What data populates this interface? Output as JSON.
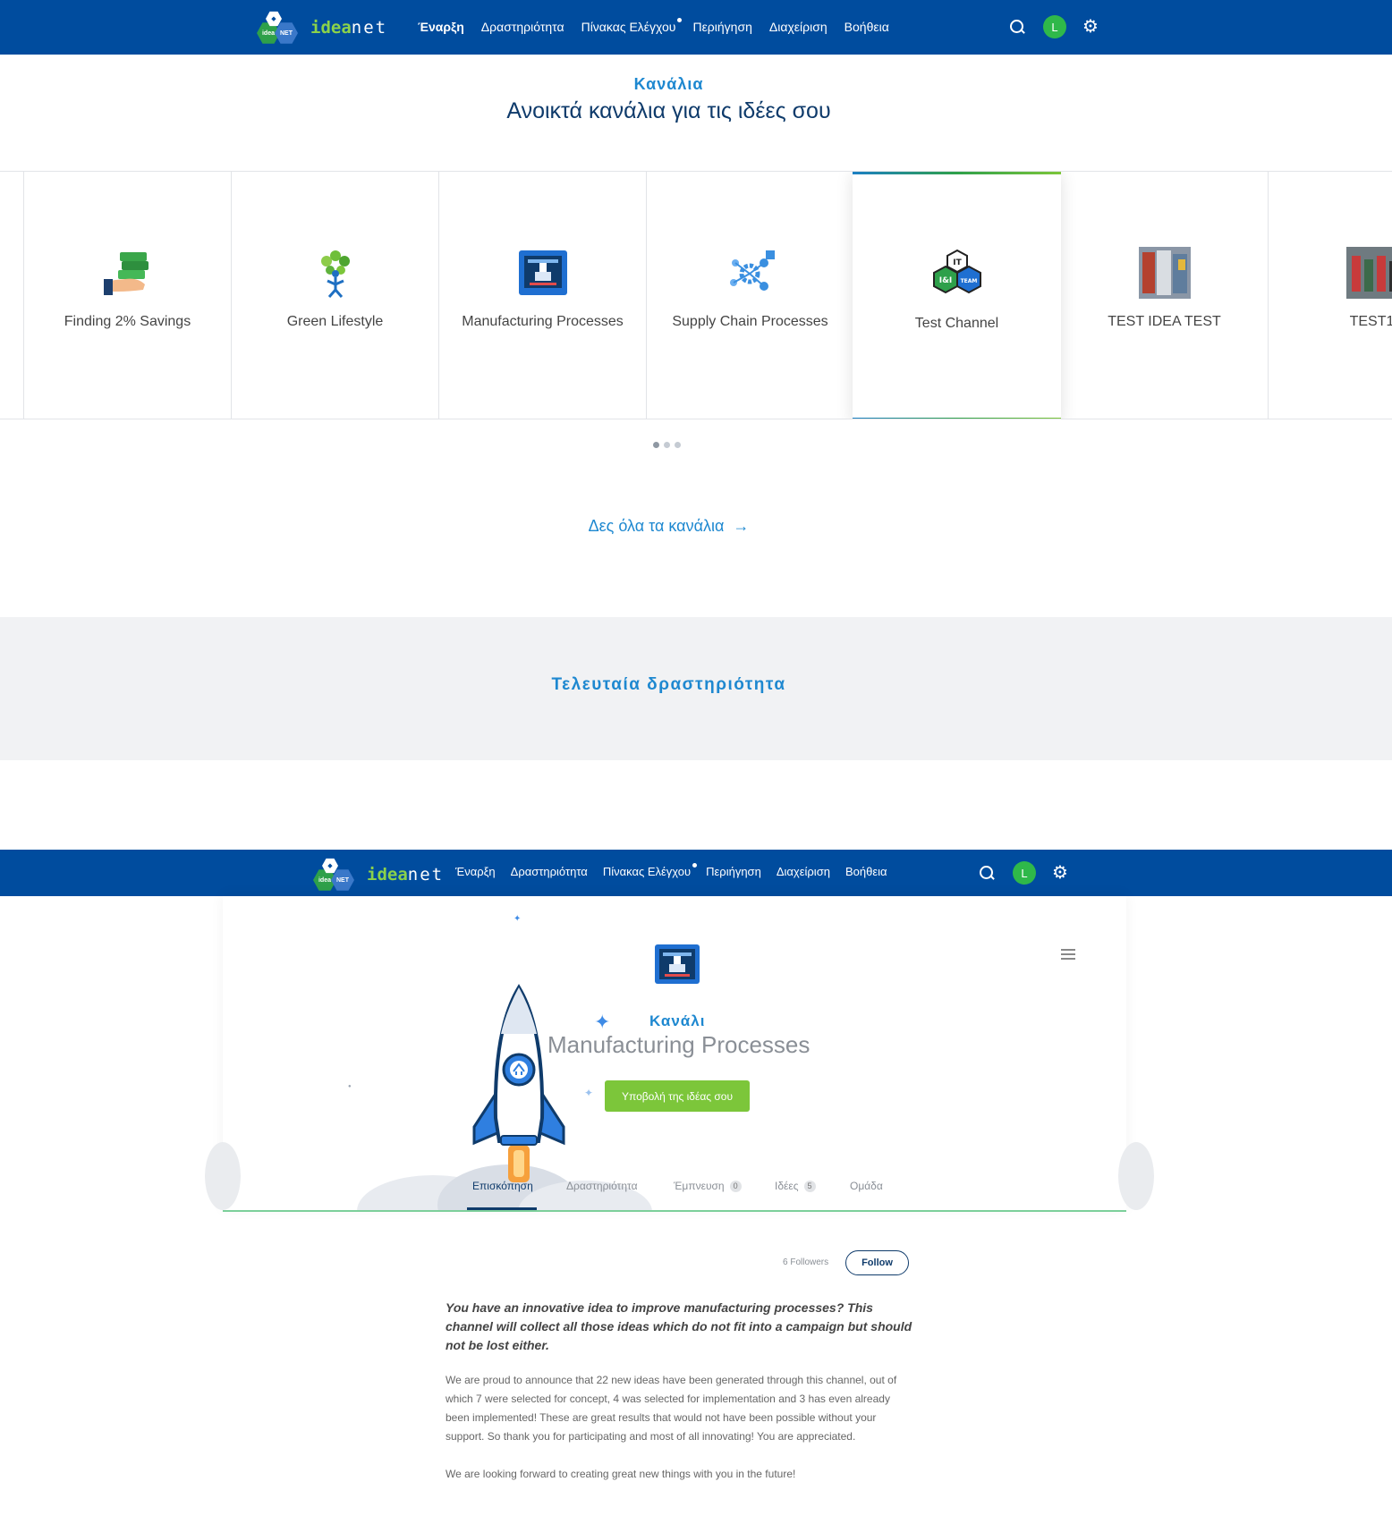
{
  "app": {
    "logo_text_brand": "idea",
    "logo_text_rest": "net",
    "logo_hex_left": "idea",
    "logo_hex_right": "NET"
  },
  "nav": {
    "items": [
      {
        "label": "Έναρξη",
        "active": true
      },
      {
        "label": "Δραστηριότητα"
      },
      {
        "label": "Πίνακας Ελέγχου",
        "dot": true
      },
      {
        "label": "Περιήγηση"
      },
      {
        "label": "Διαχείριση"
      },
      {
        "label": "Βοήθεια"
      }
    ],
    "avatar_initial": "L",
    "icons": [
      "search-icon",
      "gear-icon"
    ],
    "bar_color": "#004c9e"
  },
  "channels": {
    "eyebrow": "Κανάλια",
    "title": "Ανοικτά κανάλια για τις ιδέες σου",
    "cards": [
      {
        "label": "Finding 2% Savings",
        "icon": "money-hand-icon"
      },
      {
        "label": "Green Lifestyle",
        "icon": "tree-person-icon"
      },
      {
        "label": "Manufacturing Processes",
        "icon": "factory-printer-icon"
      },
      {
        "label": "Supply Chain Processes",
        "icon": "gears-network-icon"
      },
      {
        "label": "Test Channel",
        "icon": "ii-team-hex-icon",
        "featured": true
      },
      {
        "label": "TEST IDEA TEST",
        "icon": "photo-thumbnail-icon"
      },
      {
        "label": "TEST1",
        "icon": "photo-thumbnail-icon"
      }
    ],
    "pager": {
      "pages": 3,
      "current": 1
    },
    "see_all": "Δες όλα τα κανάλια",
    "see_all_arrow": "→"
  },
  "activity": {
    "title": "Τελευταία δραστηριότητα"
  },
  "channel_page": {
    "eyebrow": "Κανάλι",
    "name": "Manufacturing Processes",
    "submit_label": "Υποβολή της ιδέας σου",
    "tabs": [
      {
        "label": "Επισκόπηση",
        "active": true
      },
      {
        "label": "Δραστηριότητα"
      },
      {
        "label": "Έμπνευση",
        "count": "0"
      },
      {
        "label": "Ιδέες",
        "count": "5"
      },
      {
        "label": "Ομάδα"
      }
    ],
    "followers": "6 Followers",
    "follow_label": "Follow",
    "lead": "You have an innovative idea to improve manufacturing processes? This channel will collect all those ideas which do not fit into a campaign but should not be lost either.",
    "body": "We are proud to announce that 22 new ideas have been generated through this channel, out of which 7 were selected for concept, 4 was selected for implementation and 3 has even already been implemented! These are great results that would not have been possible without your support. So thank you for participating and most of all innovating! You are appreciated.",
    "closing": "We are looking forward to creating great new things with you in the future!",
    "accent_green": "#7cc63a",
    "accent_blue": "#1e88d0"
  }
}
